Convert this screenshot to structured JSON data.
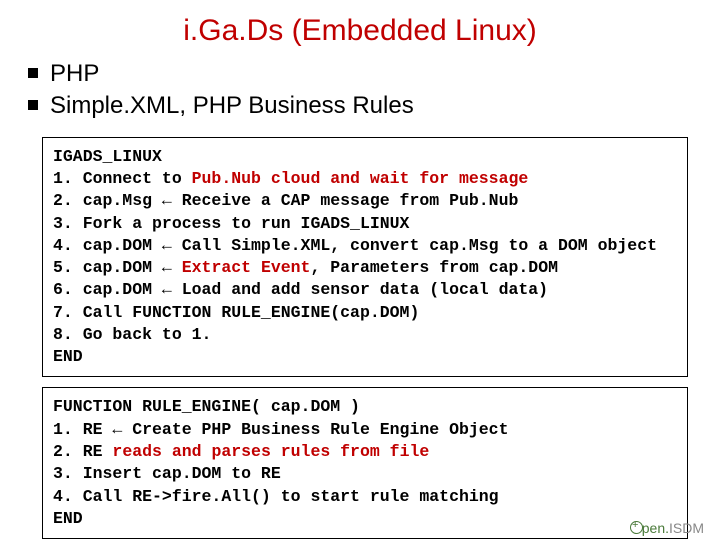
{
  "title": "i.Ga.Ds (Embedded Linux)",
  "bullets": [
    "PHP",
    "Simple.XML, PHP Business Rules"
  ],
  "box1": {
    "h": "IGADS_LINUX",
    "l1a": "1. Connect to ",
    "l1b": "Pub.Nub cloud and wait for message",
    "l2": "2. cap.Msg ← Receive a CAP message from Pub.Nub",
    "l3": "3. Fork a process to run IGADS_LINUX",
    "l4": "4. cap.DOM ← Call Simple.XML, convert cap.Msg to a DOM object",
    "l5a": "5. cap.DOM ← ",
    "l5b": "Extract Event",
    "l5c": ", Parameters from cap.DOM",
    "l6": "6. cap.DOM ← Load and add sensor data (local data)",
    "l7": "7. Call FUNCTION RULE_ENGINE(cap.DOM)",
    "l8": "8. Go back to 1.",
    "end": "END"
  },
  "box2": {
    "h": "FUNCTION RULE_ENGINE( cap.DOM )",
    "l1": "1. RE ← Create PHP Business Rule Engine Object",
    "l2a": "2. RE ",
    "l2b": "reads and parses rules from file",
    "l3": "3. Insert cap.DOM to RE",
    "l4": "4. Call RE->fire.All() to start rule matching",
    "end": "END"
  },
  "footer": {
    "pen": "pen.",
    "isdm": "ISDM"
  }
}
